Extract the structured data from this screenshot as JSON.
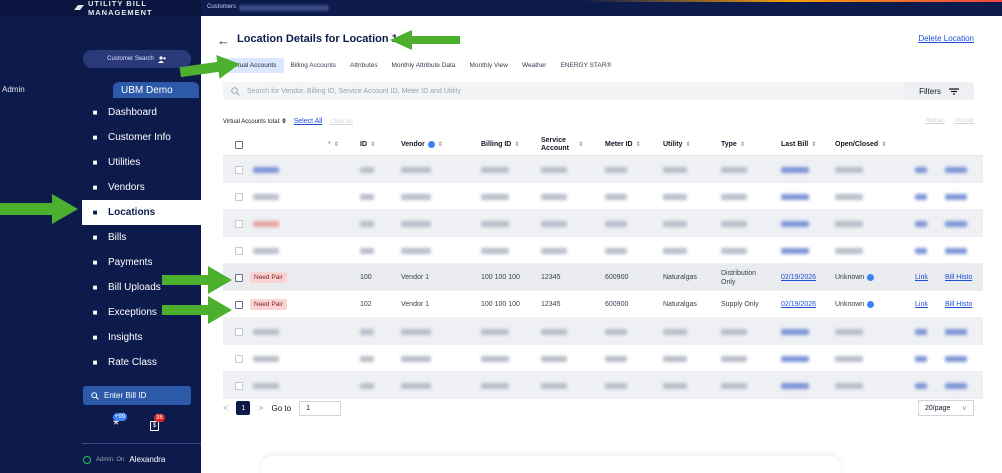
{
  "brand": {
    "name": "UTILITY BILL MANAGEMENT"
  },
  "topbar": {
    "crumb": "Customers"
  },
  "sidebar": {
    "customer_search": "Customer Search",
    "admin_label": "Admin",
    "ubm_demo": "UBM Demo",
    "items": [
      {
        "label": "Dashboard",
        "icon": "dashboard-icon"
      },
      {
        "label": "Customer Info",
        "icon": "user-icon"
      },
      {
        "label": "Utilities",
        "icon": "utility-icon"
      },
      {
        "label": "Vendors",
        "icon": "vendor-icon"
      },
      {
        "label": "Locations",
        "icon": "location-pin-icon"
      },
      {
        "label": "Bills",
        "icon": "bill-icon"
      },
      {
        "label": "Payments",
        "icon": "payment-icon"
      },
      {
        "label": "Bill Uploads",
        "icon": "upload-icon"
      },
      {
        "label": "Exceptions",
        "icon": "exception-icon"
      },
      {
        "label": "Insights",
        "icon": "insights-icon"
      },
      {
        "label": "Rate Class",
        "icon": "rate-class-icon"
      }
    ],
    "active": "Locations",
    "bill_id_placeholder": "Enter Bill ID",
    "badge_one": "+99",
    "badge_two": "38",
    "admin_on": "Admin: On",
    "user": "Alexandra"
  },
  "header": {
    "back": "←",
    "title": "Location Details for  Location 1",
    "delete": "Delete Location"
  },
  "tabs": [
    "Virtual Accounts",
    "Billing Accounts",
    "Attributes",
    "Monthly Attribute Data",
    "Monthly View",
    "Weather",
    "ENERGY STAR®"
  ],
  "active_tab": "Virtual Accounts",
  "search": {
    "placeholder": "Search for Vendor, Billing ID, Service Account ID, Meter ID and Utility"
  },
  "filters": {
    "label": "Filters"
  },
  "summary": {
    "total_label": "Virtual Accounts total:",
    "total": "9",
    "select_all": "Select All",
    "clear_all": "Clear All",
    "remap": "Remap",
    "unmap": "Unmap"
  },
  "table": {
    "headers": {
      "star": "*",
      "id": "ID",
      "vendor": "Vendor",
      "billing_id": "Billing ID",
      "service_account": "Service Account",
      "meter_id": "Meter ID",
      "utility": "Utility",
      "type": "Type",
      "last_bill": "Last Bill",
      "open_closed": "Open/Closed"
    },
    "clear_rows": [
      {
        "status": "Need Pair",
        "id": "100",
        "vendor": "Vendor 1",
        "billing_id": "100 100 100",
        "service_account": "12345",
        "meter_id": "600900",
        "utility": "Naturalgas",
        "type": "Distribution Only",
        "last_bill": "02/19/2026",
        "open_closed": "Unknown",
        "link": "Link",
        "history": "Bill Histo"
      },
      {
        "status": "Need Pair",
        "id": "102",
        "vendor": "Vendor 1",
        "billing_id": "100 100 100",
        "service_account": "12345",
        "meter_id": "600900",
        "utility": "Naturalgas",
        "type": "Supply Only",
        "last_bill": "02/19/2026",
        "open_closed": "Unknown",
        "link": "Link",
        "history": "Bill Histo"
      }
    ]
  },
  "pager": {
    "prev": "<",
    "current": "1",
    "next": ">",
    "goto_label": "Go to",
    "goto_value": "1",
    "per_page": "20/page"
  },
  "colors": {
    "sidebar": "#0d1b4c",
    "accent": "#2d5aa8",
    "arrow": "#4caf2e",
    "pair": "#fbd3d3"
  }
}
